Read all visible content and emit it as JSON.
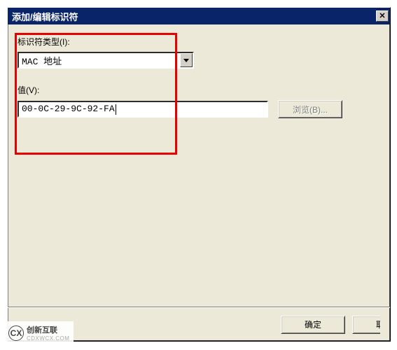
{
  "window": {
    "title": "添加/编辑标识符"
  },
  "form": {
    "type_label": "标识符类型(I):",
    "type_value": "MAC 地址",
    "value_label": "值(V):",
    "value_input": "00-0C-29-9C-92-FA",
    "browse_label": "浏览(B)..."
  },
  "buttons": {
    "ok": "确定",
    "cancel": "取消"
  },
  "watermark": {
    "logo": "CX",
    "line1": "创新互联",
    "line2": "CDXWCX.COM"
  },
  "colors": {
    "highlight": "#E80000",
    "dialog_bg": "#ECE9D8",
    "titlebar_bg": "#0A246A"
  }
}
